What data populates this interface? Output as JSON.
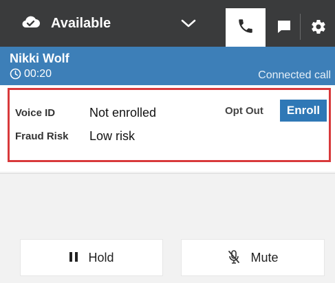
{
  "topbar": {
    "status_label": "Available",
    "status_icon": "cloud-check-icon",
    "dropdown_icon": "chevron-down-icon",
    "tabs": [
      {
        "name": "phone",
        "icon": "phone-icon",
        "active": true
      },
      {
        "name": "chat",
        "icon": "chat-icon",
        "active": false
      },
      {
        "name": "settings",
        "icon": "gear-icon",
        "active": false
      }
    ]
  },
  "contact": {
    "name": "Nikki Wolf",
    "timer": "00:20",
    "state": "Connected call"
  },
  "voice_id": {
    "label": "Voice ID",
    "value": "Not enrolled",
    "opt_out_label": "Opt Out",
    "enroll_label": "Enroll"
  },
  "fraud_risk": {
    "label": "Fraud Risk",
    "value": "Low risk"
  },
  "actions": {
    "hold_label": "Hold",
    "mute_label": "Mute"
  },
  "colors": {
    "topbar_bg": "#3a3b3c",
    "contact_bar_bg": "#3d7fb8",
    "enroll_bg": "#2f78b6",
    "highlight_border": "#d8393b",
    "page_bg": "#f2f2f2"
  }
}
